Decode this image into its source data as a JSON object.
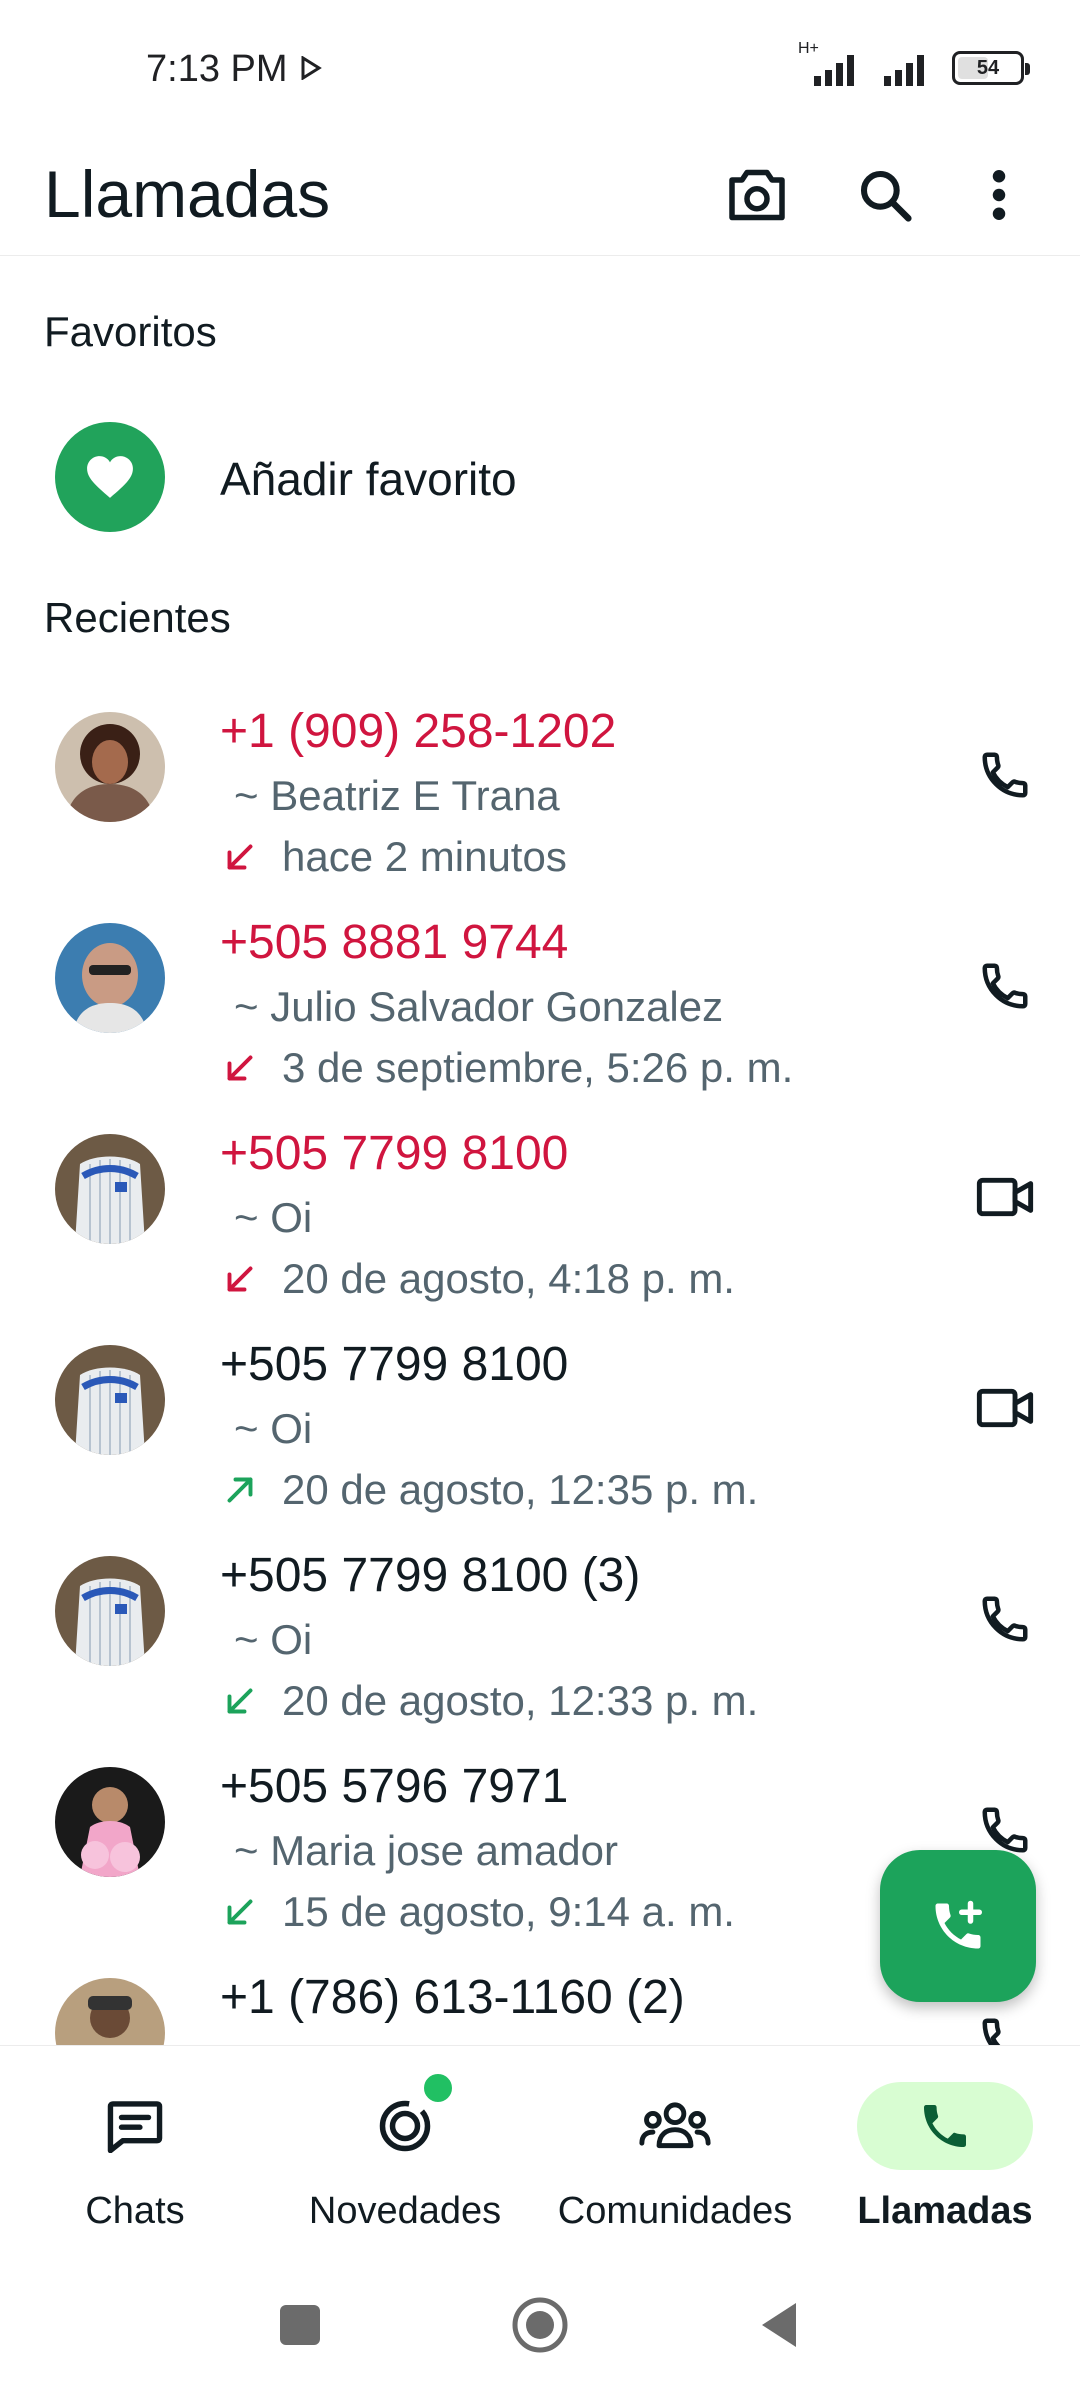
{
  "status_bar": {
    "time": "7:13 PM",
    "network_label": "H+",
    "battery": "54",
    "battery_level": 0.54
  },
  "app_bar": {
    "title": "Llamadas",
    "icons": [
      "camera-icon",
      "search-icon",
      "more-vert-icon"
    ]
  },
  "favorites": {
    "section_title": "Favoritos",
    "add_label": "Añadir favorito"
  },
  "recents": {
    "section_title": "Recientes",
    "calls": [
      {
        "name": "+1 (909) 258-1202",
        "sub": "~ Beatriz E Trana",
        "time": "hace 2 minutos",
        "missed": true,
        "direction": "incoming-missed",
        "type": "voice"
      },
      {
        "name": "+505 8881 9744",
        "sub": "~ Julio Salvador Gonzalez",
        "time": "3 de septiembre, 5:26 p. m.",
        "missed": true,
        "direction": "incoming-missed",
        "type": "voice"
      },
      {
        "name": "+505 7799 8100",
        "sub": "~ Oi",
        "time": "20 de agosto, 4:18 p. m.",
        "missed": true,
        "direction": "incoming-missed",
        "type": "video"
      },
      {
        "name": "+505 7799 8100",
        "sub": "~ Oi",
        "time": "20 de agosto, 12:35 p. m.",
        "missed": false,
        "direction": "outgoing",
        "type": "video"
      },
      {
        "name": "+505 7799 8100 (3)",
        "sub": "~ Oi",
        "time": "20 de agosto, 12:33 p. m.",
        "missed": false,
        "direction": "incoming",
        "type": "voice"
      },
      {
        "name": "+505 5796 7971",
        "sub": "~ Maria jose amador",
        "time": "15 de agosto, 9:14 a. m.",
        "missed": false,
        "direction": "incoming",
        "type": "voice"
      },
      {
        "name": "+1 (786) 613-1160 (2)",
        "sub": "",
        "time": "",
        "missed": false,
        "direction": "incoming",
        "type": "voice"
      }
    ]
  },
  "bottom_nav": {
    "items": [
      {
        "label": "Chats",
        "icon": "chat-icon",
        "active": false
      },
      {
        "label": "Novedades",
        "icon": "updates-icon",
        "active": false,
        "badge_dot": true
      },
      {
        "label": "Comunidades",
        "icon": "communities-icon",
        "active": false
      },
      {
        "label": "Llamadas",
        "icon": "phone-icon",
        "active": true
      }
    ]
  },
  "colors": {
    "accent_green": "#1ca35b",
    "missed_red": "#d0153f",
    "active_pill": "#d8fdd2"
  }
}
